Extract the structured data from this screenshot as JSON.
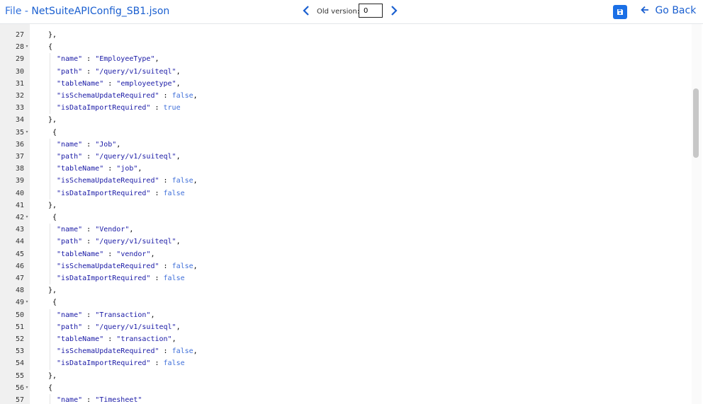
{
  "header": {
    "title_prefix": "File - ",
    "file_name": "NetSuiteAPIConfig_SB1.json",
    "prev_version_icon": "chevron-left-icon",
    "next_version_icon": "chevron-right-icon",
    "old_version_label": "Old version:",
    "old_version_value": "0",
    "save_icon": "floppy-disk-icon",
    "go_back_label": "Go Back"
  },
  "colors": {
    "accent": "#1a5fd0",
    "save_button": "#1a6fe6",
    "string": "#1a1aa6",
    "keyword": "#3f6fd9",
    "gutter": "#f0f0f0"
  },
  "editor": {
    "lines": [
      {
        "num": "27",
        "fold": false,
        "indent": 1,
        "parts": [
          {
            "t": "},"
          }
        ]
      },
      {
        "num": "28",
        "fold": true,
        "indent": 1,
        "parts": [
          {
            "t": "{"
          }
        ]
      },
      {
        "num": "29",
        "fold": false,
        "indent": 2,
        "parts": [
          {
            "t": "\"name\"",
            "c": "s"
          },
          {
            "t": " : "
          },
          {
            "t": "\"EmployeeType\"",
            "c": "s"
          },
          {
            "t": ","
          }
        ]
      },
      {
        "num": "30",
        "fold": false,
        "indent": 2,
        "parts": [
          {
            "t": "\"path\"",
            "c": "s"
          },
          {
            "t": " : "
          },
          {
            "t": "\"/query/v1/suiteql\"",
            "c": "s"
          },
          {
            "t": ","
          }
        ]
      },
      {
        "num": "31",
        "fold": false,
        "indent": 2,
        "parts": [
          {
            "t": "\"tableName\"",
            "c": "s"
          },
          {
            "t": " : "
          },
          {
            "t": "\"employeetype\"",
            "c": "s"
          },
          {
            "t": ","
          }
        ]
      },
      {
        "num": "32",
        "fold": false,
        "indent": 2,
        "parts": [
          {
            "t": "\"isSchemaUpdateRequired\"",
            "c": "s"
          },
          {
            "t": " : "
          },
          {
            "t": "false",
            "c": "k"
          },
          {
            "t": ","
          }
        ]
      },
      {
        "num": "33",
        "fold": false,
        "indent": 2,
        "parts": [
          {
            "t": "\"isDataImportRequired\"",
            "c": "s"
          },
          {
            "t": " : "
          },
          {
            "t": "true",
            "c": "k"
          }
        ]
      },
      {
        "num": "34",
        "fold": false,
        "indent": 1,
        "parts": [
          {
            "t": "},"
          }
        ]
      },
      {
        "num": "35",
        "fold": true,
        "indent": 1,
        "parts": [
          {
            "t": " {"
          }
        ]
      },
      {
        "num": "36",
        "fold": false,
        "indent": 2,
        "parts": [
          {
            "t": "\"name\"",
            "c": "s"
          },
          {
            "t": " : "
          },
          {
            "t": "\"Job\"",
            "c": "s"
          },
          {
            "t": ","
          }
        ]
      },
      {
        "num": "37",
        "fold": false,
        "indent": 2,
        "parts": [
          {
            "t": "\"path\"",
            "c": "s"
          },
          {
            "t": " : "
          },
          {
            "t": "\"/query/v1/suiteql\"",
            "c": "s"
          },
          {
            "t": ","
          }
        ]
      },
      {
        "num": "38",
        "fold": false,
        "indent": 2,
        "parts": [
          {
            "t": "\"tableName\"",
            "c": "s"
          },
          {
            "t": " : "
          },
          {
            "t": "\"job\"",
            "c": "s"
          },
          {
            "t": ","
          }
        ]
      },
      {
        "num": "39",
        "fold": false,
        "indent": 2,
        "parts": [
          {
            "t": "\"isSchemaUpdateRequired\"",
            "c": "s"
          },
          {
            "t": " : "
          },
          {
            "t": "false",
            "c": "k"
          },
          {
            "t": ","
          }
        ]
      },
      {
        "num": "40",
        "fold": false,
        "indent": 2,
        "parts": [
          {
            "t": "\"isDataImportRequired\"",
            "c": "s"
          },
          {
            "t": " : "
          },
          {
            "t": "false",
            "c": "k"
          }
        ]
      },
      {
        "num": "41",
        "fold": false,
        "indent": 1,
        "parts": [
          {
            "t": "},"
          }
        ]
      },
      {
        "num": "42",
        "fold": true,
        "indent": 1,
        "parts": [
          {
            "t": " {"
          }
        ]
      },
      {
        "num": "43",
        "fold": false,
        "indent": 2,
        "parts": [
          {
            "t": "\"name\"",
            "c": "s"
          },
          {
            "t": " : "
          },
          {
            "t": "\"Vendor\"",
            "c": "s"
          },
          {
            "t": ","
          }
        ]
      },
      {
        "num": "44",
        "fold": false,
        "indent": 2,
        "parts": [
          {
            "t": "\"path\"",
            "c": "s"
          },
          {
            "t": " : "
          },
          {
            "t": "\"/query/v1/suiteql\"",
            "c": "s"
          },
          {
            "t": ","
          }
        ]
      },
      {
        "num": "45",
        "fold": false,
        "indent": 2,
        "parts": [
          {
            "t": "\"tableName\"",
            "c": "s"
          },
          {
            "t": " : "
          },
          {
            "t": "\"vendor\"",
            "c": "s"
          },
          {
            "t": ","
          }
        ]
      },
      {
        "num": "46",
        "fold": false,
        "indent": 2,
        "parts": [
          {
            "t": "\"isSchemaUpdateRequired\"",
            "c": "s"
          },
          {
            "t": " : "
          },
          {
            "t": "false",
            "c": "k"
          },
          {
            "t": ","
          }
        ]
      },
      {
        "num": "47",
        "fold": false,
        "indent": 2,
        "parts": [
          {
            "t": "\"isDataImportRequired\"",
            "c": "s"
          },
          {
            "t": " : "
          },
          {
            "t": "false",
            "c": "k"
          }
        ]
      },
      {
        "num": "48",
        "fold": false,
        "indent": 1,
        "parts": [
          {
            "t": "},"
          }
        ]
      },
      {
        "num": "49",
        "fold": true,
        "indent": 1,
        "parts": [
          {
            "t": " {"
          }
        ]
      },
      {
        "num": "50",
        "fold": false,
        "indent": 2,
        "parts": [
          {
            "t": "\"name\"",
            "c": "s"
          },
          {
            "t": " : "
          },
          {
            "t": "\"Transaction\"",
            "c": "s"
          },
          {
            "t": ","
          }
        ]
      },
      {
        "num": "51",
        "fold": false,
        "indent": 2,
        "parts": [
          {
            "t": "\"path\"",
            "c": "s"
          },
          {
            "t": " : "
          },
          {
            "t": "\"/query/v1/suiteql\"",
            "c": "s"
          },
          {
            "t": ","
          }
        ]
      },
      {
        "num": "52",
        "fold": false,
        "indent": 2,
        "parts": [
          {
            "t": "\"tableName\"",
            "c": "s"
          },
          {
            "t": " : "
          },
          {
            "t": "\"transaction\"",
            "c": "s"
          },
          {
            "t": ","
          }
        ]
      },
      {
        "num": "53",
        "fold": false,
        "indent": 2,
        "parts": [
          {
            "t": "\"isSchemaUpdateRequired\"",
            "c": "s"
          },
          {
            "t": " : "
          },
          {
            "t": "false",
            "c": "k"
          },
          {
            "t": ","
          }
        ]
      },
      {
        "num": "54",
        "fold": false,
        "indent": 2,
        "parts": [
          {
            "t": "\"isDataImportRequired\"",
            "c": "s"
          },
          {
            "t": " : "
          },
          {
            "t": "false",
            "c": "k"
          }
        ]
      },
      {
        "num": "55",
        "fold": false,
        "indent": 1,
        "parts": [
          {
            "t": "},"
          }
        ]
      },
      {
        "num": "56",
        "fold": true,
        "indent": 1,
        "parts": [
          {
            "t": "{"
          }
        ]
      },
      {
        "num": "57",
        "fold": false,
        "indent": 2,
        "parts": [
          {
            "t": "\"name\"",
            "c": "s"
          },
          {
            "t": " : "
          },
          {
            "t": "\"Timesheet\"",
            "c": "s"
          }
        ]
      }
    ]
  }
}
